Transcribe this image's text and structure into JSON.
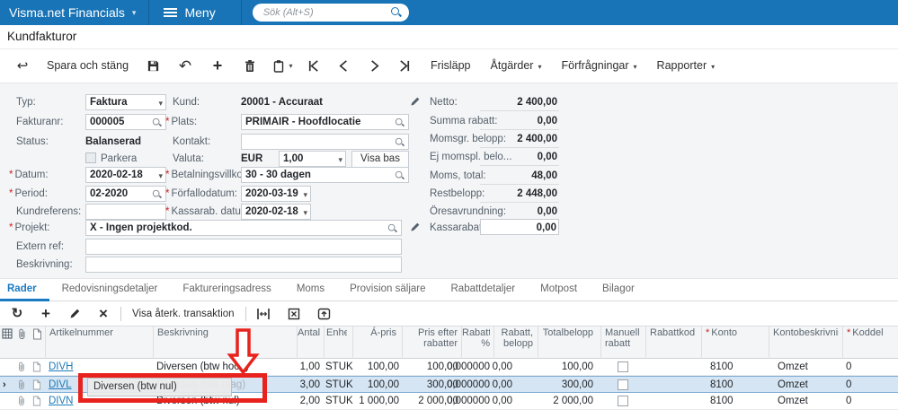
{
  "topbar": {
    "app_title": "Visma.net Financials",
    "menu_label": "Meny",
    "search_placeholder": "Sök (Alt+S)"
  },
  "page": {
    "title": "Kundfakturor"
  },
  "toolbar": {
    "save_close": "Spara och stäng",
    "frislapp": "Frisläpp",
    "atgarder": "Åtgärder",
    "forfragningar": "Förfrågningar",
    "rapporter": "Rapporter"
  },
  "form": {
    "typ": {
      "label": "Typ:",
      "value": "Faktura"
    },
    "fakturanr": {
      "label": "Fakturanr:",
      "value": "000005"
    },
    "status": {
      "label": "Status:",
      "value": "Balanserad"
    },
    "parkera": {
      "label": "Parkera"
    },
    "datum": {
      "label": "Datum:",
      "value": "2020-02-18"
    },
    "period": {
      "label": "Period:",
      "value": "02-2020"
    },
    "kundreferens": {
      "label": "Kundreferens:",
      "value": ""
    },
    "projekt": {
      "label": "Projekt:",
      "value": "X - Ingen projektkod."
    },
    "extern_ref": {
      "label": "Extern ref:",
      "value": ""
    },
    "beskrivning": {
      "label": "Beskrivning:",
      "value": ""
    },
    "kund": {
      "label": "Kund:",
      "value": "20001 - Accuraat"
    },
    "plats": {
      "label": "Plats:",
      "value": "PRIMAIR - Hoofdlocatie"
    },
    "kontakt": {
      "label": "Kontakt:",
      "value": ""
    },
    "valuta": {
      "label": "Valuta:",
      "code": "EUR",
      "rate": "1,00",
      "visa_bas": "Visa bas"
    },
    "betalningsvillkor": {
      "label": "Betalningsvillkor:",
      "value": "30 - 30 dagen"
    },
    "forfallodatum": {
      "label": "Förfallodatum:",
      "value": "2020-03-19"
    },
    "kassarab_datum": {
      "label": "Kassarab. datum:",
      "value": "2020-02-18"
    },
    "totals": [
      {
        "label": "Netto:",
        "value": "2 400,00"
      },
      {
        "label": "Summa rabatt:",
        "value": "0,00"
      },
      {
        "label": "Momsgr. belopp:",
        "value": "2 400,00"
      },
      {
        "label": "Ej momspl. belo...",
        "value": "0,00"
      },
      {
        "label": "Moms, total:",
        "value": "48,00"
      },
      {
        "label": "Restbelopp:",
        "value": "2 448,00"
      },
      {
        "label": "Öresavrundning:",
        "value": "0,00"
      },
      {
        "label": "Kassarabatt:",
        "value": "0,00"
      }
    ]
  },
  "tabs": {
    "items": [
      "Rader",
      "Redovisningsdetaljer",
      "Faktureringsadress",
      "Moms",
      "Provision säljare",
      "Rabattdetaljer",
      "Motpost",
      "Bilagor"
    ],
    "active": "Rader"
  },
  "grid_toolbar": {
    "visa_aterk": "Visa återk. transaktion"
  },
  "table": {
    "headers": {
      "artikelnummer": "Artikelnummer",
      "beskrivning": "Beskrivning",
      "antal": "Antal",
      "enhet": "Enhet",
      "apris": "Á-pris",
      "pris_efter": "Pris efter rabatter",
      "rabatt_pct": "Rabatt, %",
      "rabatt_belopp": "Rabatt, belopp",
      "totalbelopp": "Totalbelopp",
      "manuell_rabatt": "Manuell rabatt",
      "rabattkod": "Rabattkod",
      "konto": "Konto",
      "kontobeskrivning": "Kontobeskrivning",
      "koddel": "Koddel"
    },
    "rows": [
      {
        "artikelnummer": "DIVH",
        "beskrivning": "Diversen (btw hoog)",
        "antal": "1,00",
        "enhet": "STUK",
        "apris": "100,00",
        "pris_efter": "100,00",
        "rabatt_pct": "0,000000",
        "rabatt_belopp": "0,00",
        "totalbelopp": "100,00",
        "rabattkod": "",
        "konto": "8100",
        "kontobeskrivning": "Omzet",
        "koddel": "0"
      },
      {
        "artikelnummer": "DIVL",
        "beskrivning": "Diversen (btw laag)",
        "antal": "3,00",
        "enhet": "STUK",
        "apris": "100,00",
        "pris_efter": "300,00",
        "rabatt_pct": "0,000000",
        "rabatt_belopp": "0,00",
        "totalbelopp": "300,00",
        "rabattkod": "",
        "konto": "8100",
        "kontobeskrivning": "Omzet",
        "koddel": "0"
      },
      {
        "artikelnummer": "DIVN",
        "beskrivning": "Diversen (btw nul)",
        "antal": "2,00",
        "enhet": "STUK",
        "apris": "1 000,00",
        "pris_efter": "2 000,00",
        "rabatt_pct": "0,000000",
        "rabatt_belopp": "0,00",
        "totalbelopp": "2 000,00",
        "rabattkod": "",
        "konto": "8100",
        "kontobeskrivning": "Omzet",
        "koddel": "0"
      }
    ]
  },
  "annotation": {
    "drag_ghost_text": "Diversen (btw nul)"
  }
}
